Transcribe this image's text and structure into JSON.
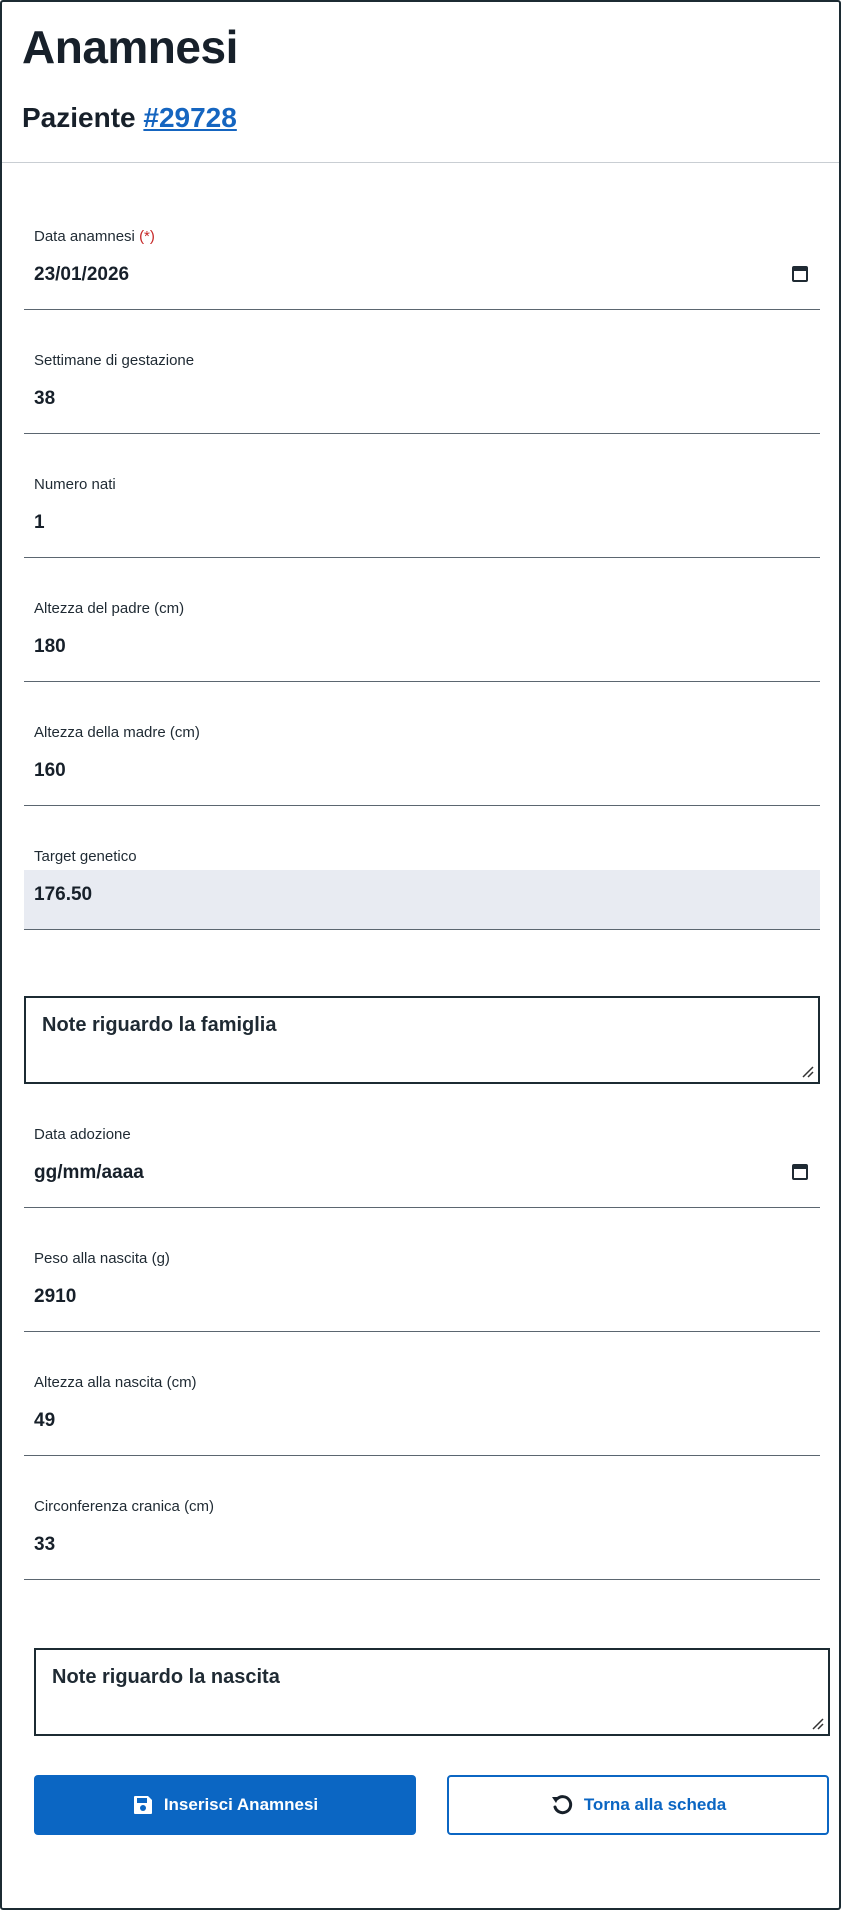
{
  "header": {
    "title": "Anamnesi",
    "patient_prefix": "Paziente",
    "patient_id": "#29728"
  },
  "form": {
    "data_anamnesi": {
      "label": "Data anamnesi ",
      "required_mark": "(*)",
      "value": "23/01/2026"
    },
    "settimane_gestazione": {
      "label": "Settimane di gestazione",
      "value": "38"
    },
    "numero_nati": {
      "label": "Numero nati",
      "value": "1"
    },
    "altezza_padre": {
      "label": "Altezza del padre (cm)",
      "value": "180"
    },
    "altezza_madre": {
      "label": "Altezza della madre (cm)",
      "value": "160"
    },
    "target_genetico": {
      "label": "Target genetico",
      "value": "176.50"
    },
    "note_famiglia": {
      "placeholder": "Note riguardo la famiglia"
    },
    "data_adozione": {
      "label": "Data adozione",
      "value": "gg/mm/aaaa"
    },
    "peso_nascita": {
      "label": "Peso alla nascita (g)",
      "value": "2910"
    },
    "altezza_nascita": {
      "label": "Altezza alla nascita (cm)",
      "value": "49"
    },
    "circonferenza_cranica": {
      "label": "Circonferenza cranica (cm)",
      "value": "33"
    },
    "note_nascita": {
      "placeholder": "Note riguardo la nascita"
    }
  },
  "actions": {
    "insert_label": "Inserisci Anamnesi",
    "back_label": "Torna alla scheda"
  },
  "icons": {
    "calendar": "calendar-icon",
    "save": "save-icon",
    "undo": "undo-icon",
    "resize": "resize-grip-icon"
  },
  "colors": {
    "primary": "#0b66c3",
    "link": "#1565c0",
    "required": "#c62828",
    "readonly_bg": "#e8ebf2"
  }
}
